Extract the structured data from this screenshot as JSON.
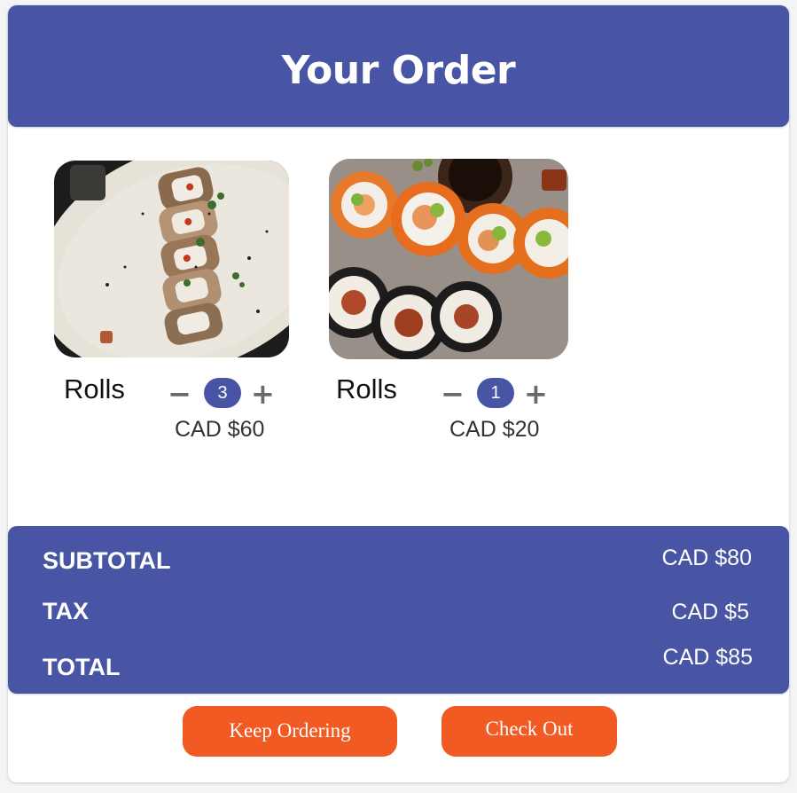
{
  "header": {
    "title": "Your Order"
  },
  "items": [
    {
      "name": "Rolls",
      "quantity": "3",
      "minus": "−",
      "plus": "+",
      "price": "CAD $60"
    },
    {
      "name": "Rolls",
      "quantity": "1",
      "minus": "−",
      "plus": "+",
      "price": "CAD $20"
    }
  ],
  "summary": {
    "subtotal_label": "SUBTOTAL",
    "subtotal_value": "CAD $80",
    "tax_label": "TAX",
    "tax_value": "CAD $5",
    "total_label": "TOTAL",
    "total_value": "CAD $85"
  },
  "actions": {
    "keep_ordering": "Keep Ordering",
    "check_out": "Check Out"
  },
  "colors": {
    "brand": "#4854a4",
    "accent": "#f15a22"
  }
}
